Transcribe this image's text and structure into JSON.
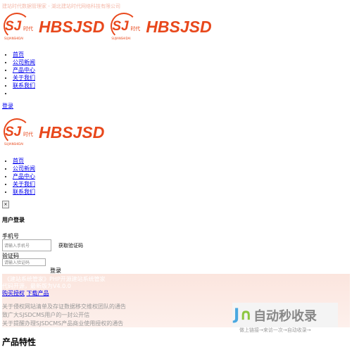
{
  "top_text": "建站时代数据管理家 - 湖北建站时代网络科技有限公司",
  "logo": {
    "mark": "SJ",
    "cn": "时代",
    "sub": "SUJIANSHIDAI",
    "wordmark": "HBSJSD"
  },
  "nav": [
    "首页",
    "公司新闻",
    "产品中心",
    "关于我们",
    "联系我们"
  ],
  "login_link": "登录",
  "close_label": "×",
  "login": {
    "title": "用户登录",
    "phone_label": "手机号",
    "phone_placeholder": "请输入手机号",
    "get_code": "获取验证码",
    "code_label": "验证码",
    "code_placeholder": "请输入验证码",
    "submit": "登录"
  },
  "banner": {
    "line1": "《建站系统管家》PHP开源建站系统管家",
    "line2": "代码开源，最新版为V4.0.0",
    "links": [
      "购买授权",
      "下载产品"
    ],
    "notices": [
      "关于侵权网站清单及存证数据移交维权团队的通告",
      "致广大SJSDCMS用户的一封公开信",
      "关于提醒办理SJSDCMS产品商业使用授权的通告"
    ]
  },
  "watermark": {
    "main": "自动秒收录",
    "sub": "做上链接→来访一次→自动收录→"
  },
  "section_title": "产品特性",
  "colors": {
    "brand": "#e8481c",
    "banner": "#fbe5de"
  }
}
